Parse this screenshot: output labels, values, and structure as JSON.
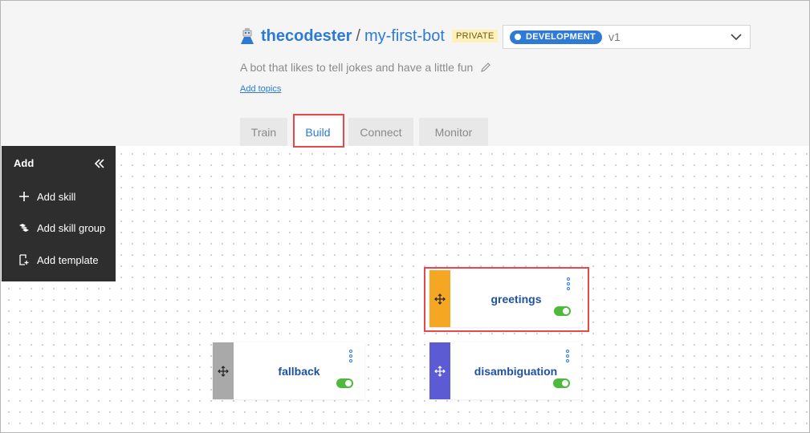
{
  "header": {
    "owner": "thecodester",
    "separator": "/",
    "bot_name": "my-first-bot",
    "visibility_badge": "PRIVATE",
    "environment": {
      "badge": "DEVELOPMENT",
      "version": "v1"
    },
    "description": "A bot that likes to tell jokes and have a little fun",
    "add_topics_link": "Add topics"
  },
  "tabs": [
    {
      "label": "Train",
      "active": false
    },
    {
      "label": "Build",
      "active": true
    },
    {
      "label": "Connect",
      "active": false
    },
    {
      "label": "Monitor",
      "active": false
    }
  ],
  "add_panel": {
    "title": "Add",
    "items": [
      {
        "label": "Add skill",
        "icon": "plus-icon"
      },
      {
        "label": "Add skill group",
        "icon": "skill-group-icon"
      },
      {
        "label": "Add template",
        "icon": "template-icon"
      }
    ]
  },
  "skills": [
    {
      "name": "greetings",
      "color": "#f5a623",
      "enabled": true
    },
    {
      "name": "fallback",
      "color": "#a9a9a9",
      "enabled": true
    },
    {
      "name": "disambiguation",
      "color": "#5d5bd4",
      "enabled": true
    }
  ],
  "colors": {
    "accent": "#2b7bd6",
    "highlight": "#e5484d",
    "toggle_on": "#4dba3c"
  }
}
